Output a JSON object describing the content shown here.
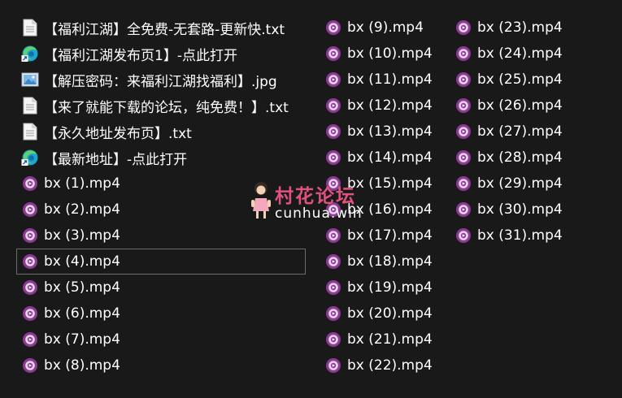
{
  "columns": [
    [
      {
        "name": "【福利江湖】全免费-无套路-更新快.txt",
        "icon": "text-file-icon"
      },
      {
        "name": "【福利江湖发布页1】-点此打开",
        "icon": "edge-shortcut-icon"
      },
      {
        "name": "【解压密码：来福利江湖找福利】.jpg",
        "icon": "image-file-icon"
      },
      {
        "name": "【来了就能下载的论坛，纯免费！】.txt",
        "icon": "text-file-icon"
      },
      {
        "name": "【永久地址发布页】.txt",
        "icon": "text-file-icon"
      },
      {
        "name": "【最新地址】-点此打开",
        "icon": "edge-shortcut-icon"
      },
      {
        "name": "bx (1).mp4",
        "icon": "video-file-icon"
      },
      {
        "name": "bx (2).mp4",
        "icon": "video-file-icon"
      },
      {
        "name": "bx (3).mp4",
        "icon": "video-file-icon"
      },
      {
        "name": "bx (4).mp4",
        "icon": "video-file-icon",
        "selected": true
      },
      {
        "name": "bx (5).mp4",
        "icon": "video-file-icon"
      },
      {
        "name": "bx (6).mp4",
        "icon": "video-file-icon"
      },
      {
        "name": "bx (7).mp4",
        "icon": "video-file-icon"
      },
      {
        "name": "bx (8).mp4",
        "icon": "video-file-icon"
      }
    ],
    [
      {
        "name": "bx (9).mp4",
        "icon": "video-file-icon"
      },
      {
        "name": "bx (10).mp4",
        "icon": "video-file-icon"
      },
      {
        "name": "bx (11).mp4",
        "icon": "video-file-icon"
      },
      {
        "name": "bx (12).mp4",
        "icon": "video-file-icon"
      },
      {
        "name": "bx (13).mp4",
        "icon": "video-file-icon"
      },
      {
        "name": "bx (14).mp4",
        "icon": "video-file-icon"
      },
      {
        "name": "bx (15).mp4",
        "icon": "video-file-icon"
      },
      {
        "name": "bx (16).mp4",
        "icon": "video-file-icon"
      },
      {
        "name": "bx (17).mp4",
        "icon": "video-file-icon"
      },
      {
        "name": "bx (18).mp4",
        "icon": "video-file-icon"
      },
      {
        "name": "bx (19).mp4",
        "icon": "video-file-icon"
      },
      {
        "name": "bx (20).mp4",
        "icon": "video-file-icon"
      },
      {
        "name": "bx (21).mp4",
        "icon": "video-file-icon"
      },
      {
        "name": "bx (22).mp4",
        "icon": "video-file-icon"
      }
    ],
    [
      {
        "name": "bx (23).mp4",
        "icon": "video-file-icon"
      },
      {
        "name": "bx (24).mp4",
        "icon": "video-file-icon"
      },
      {
        "name": "bx (25).mp4",
        "icon": "video-file-icon"
      },
      {
        "name": "bx (26).mp4",
        "icon": "video-file-icon"
      },
      {
        "name": "bx (27).mp4",
        "icon": "video-file-icon"
      },
      {
        "name": "bx (28).mp4",
        "icon": "video-file-icon"
      },
      {
        "name": "bx (29).mp4",
        "icon": "video-file-icon"
      },
      {
        "name": "bx (30).mp4",
        "icon": "video-file-icon"
      },
      {
        "name": "bx (31).mp4",
        "icon": "video-file-icon"
      }
    ]
  ],
  "watermark": {
    "title": "村花论坛",
    "subtitle": "cunhua.win",
    "icon": "girl-mascot-icon"
  },
  "colors": {
    "background": "#191919",
    "text": "#ffffff",
    "selection_border": "#6b6b6b",
    "video_icon": "#8c3a94",
    "watermark": "#e0527e"
  }
}
